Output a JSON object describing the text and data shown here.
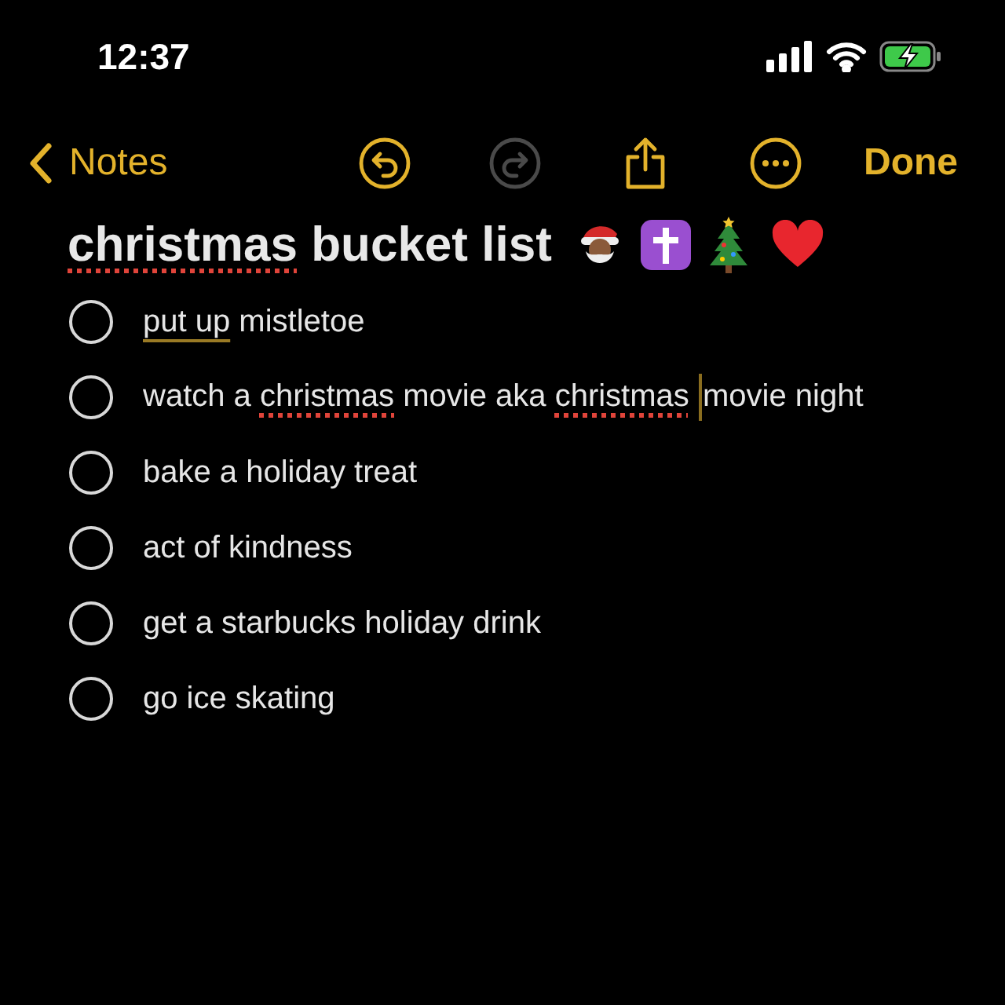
{
  "status_bar": {
    "time": "12:37",
    "charging": true
  },
  "nav": {
    "back_label": "Notes",
    "tools": [
      {
        "kind": "undo",
        "disabled": false
      },
      {
        "kind": "redo",
        "disabled": true
      },
      {
        "kind": "share",
        "disabled": false
      },
      {
        "kind": "more",
        "disabled": false
      }
    ],
    "done_label": "Done"
  },
  "note": {
    "title": [
      {
        "text": "christmas",
        "misspelled": true
      },
      {
        "text": " bucket list"
      }
    ],
    "items": [
      {
        "checked": false,
        "segments": [
          {
            "text": "put up",
            "suggested": true
          },
          {
            "text": " mistletoe"
          }
        ]
      },
      {
        "checked": false,
        "segments": [
          {
            "text": "watch a "
          },
          {
            "text": "christmas",
            "misspelled": true
          },
          {
            "text": " movie aka "
          },
          {
            "text": "christmas",
            "misspelled": true
          },
          {
            "text": "movie night",
            "cursor_before": true
          }
        ]
      },
      {
        "checked": false,
        "segments": [
          {
            "text": "bake a holiday treat"
          }
        ]
      },
      {
        "checked": false,
        "segments": [
          {
            "text": "act of kindness"
          }
        ]
      },
      {
        "checked": false,
        "segments": [
          {
            "text": "get a starbucks holiday drink"
          }
        ]
      },
      {
        "checked": false,
        "segments": [
          {
            "text": "go ice skating"
          }
        ]
      }
    ]
  }
}
